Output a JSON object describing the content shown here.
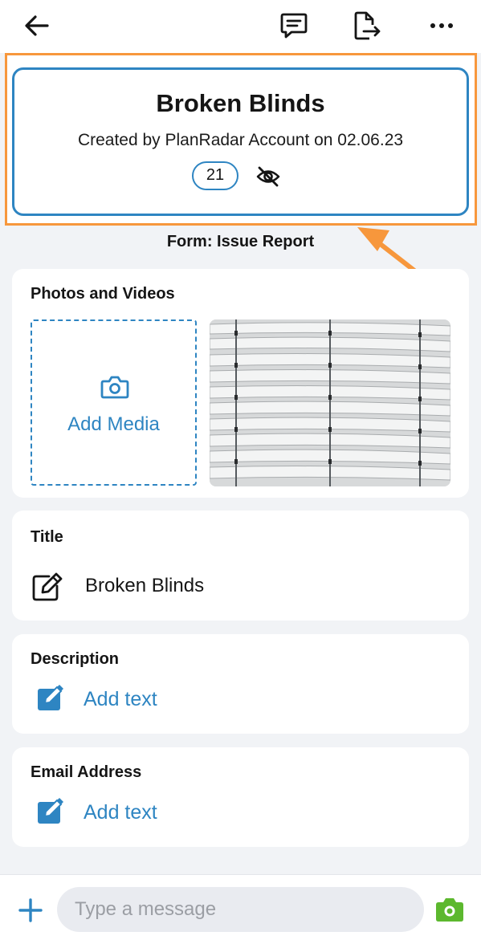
{
  "header": {
    "title": "Broken Blinds",
    "created_line": "Created by PlanRadar Account on 02.06.23",
    "badge_count": "21",
    "form_label": "Form: Issue Report"
  },
  "media_section": {
    "heading": "Photos and Videos",
    "add_media_label": "Add Media"
  },
  "title_section": {
    "heading": "Title",
    "value": "Broken Blinds"
  },
  "description_section": {
    "heading": "Description",
    "add_text": "Add text"
  },
  "email_section": {
    "heading": "Email Address",
    "add_text": "Add text"
  },
  "composer": {
    "placeholder": "Type a message"
  },
  "icons": {
    "back": "arrow-left-icon",
    "comment": "comment-icon",
    "export": "export-icon",
    "more": "more-horizontal-icon",
    "visibility": "eye-off-icon",
    "media": "camera-outline-icon",
    "edit": "edit-icon",
    "add": "plus-icon",
    "camera": "camera-filled-icon"
  },
  "colors": {
    "accent": "#2e85c2",
    "highlight": "#f7973c",
    "camera_button": "#5cb82e"
  }
}
